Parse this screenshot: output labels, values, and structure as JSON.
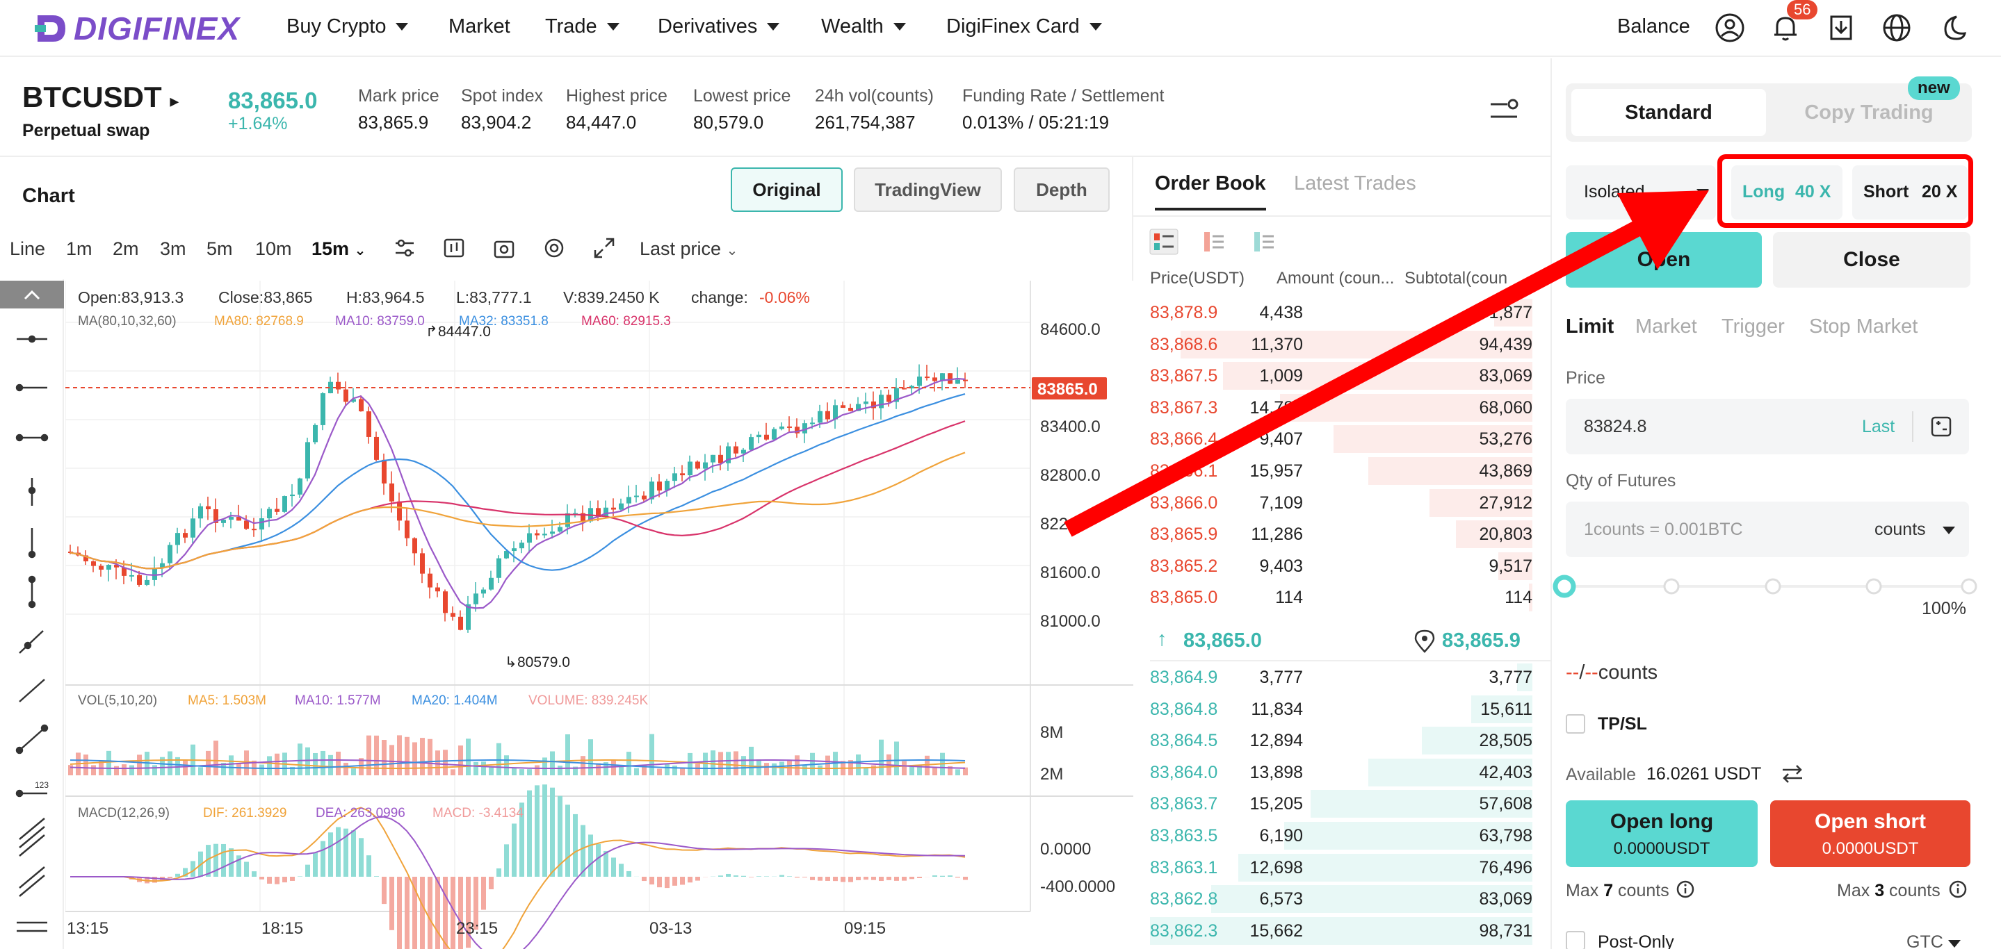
{
  "nav": {
    "logo": "DIGIFINEX",
    "items": [
      "Buy Crypto",
      "Market",
      "Trade",
      "Derivatives",
      "Wealth",
      "DigiFinex Card"
    ],
    "balance": "Balance",
    "notif_count": "56"
  },
  "ticker": {
    "symbol": "BTCUSDT",
    "type": "Perpetual swap",
    "last": "83,865.0",
    "change": "+1.64%",
    "stats": [
      {
        "label": "Mark price",
        "value": "83,865.9"
      },
      {
        "label": "Spot index",
        "value": "83,904.2"
      },
      {
        "label": "Highest price",
        "value": "84,447.0"
      },
      {
        "label": "Lowest price",
        "value": "80,579.0"
      },
      {
        "label": "24h vol(counts)",
        "value": "261,754,387"
      },
      {
        "label": "Funding Rate / Settlement",
        "value": "0.013% / 05:21:19"
      }
    ]
  },
  "chart": {
    "title": "Chart",
    "views": [
      "Original",
      "TradingView",
      "Depth"
    ],
    "active_view": "Original",
    "intervals": [
      "Line",
      "1m",
      "2m",
      "3m",
      "5m",
      "10m",
      "15m"
    ],
    "active_interval": "15m",
    "price_type": "Last price",
    "ohlc": {
      "open": "Open:83,913.3",
      "close": "Close:83,865",
      "high": "H:83,964.5",
      "low": "L:83,777.1",
      "vol": "V:839.2450 K",
      "change_label": "change:",
      "change_val": "-0.06%"
    },
    "ma": {
      "label": "MA(80,10,32,60)",
      "ma80": "MA80: 82768.9",
      "ma10": "MA10: 83759.0",
      "ma32": "MA32: 83351.8",
      "ma60": "MA60: 82915.3"
    },
    "vol_legend": {
      "label": "VOL(5,10,20)",
      "ma5": "MA5: 1.503M",
      "ma10": "MA10: 1.577M",
      "ma20": "MA20: 1.404M",
      "volume": "VOLUME: 839.245K"
    },
    "macd_legend": {
      "label": "MACD(12,26,9)",
      "dif": "DIF: 261.3929",
      "dea": "DEA: 263.0996",
      "macd": "MACD: -3.4134"
    },
    "price_axis": [
      "84600.0",
      "83400.0",
      "82800.0",
      "822",
      "81600.0",
      "81000.0"
    ],
    "current_price_tag": "83865.0",
    "high_marker": "84447.0",
    "low_marker": "80579.0",
    "vol_axis": [
      "8M",
      "2M"
    ],
    "macd_axis": [
      "0.0000",
      "-400.0000"
    ],
    "time_axis": [
      "13:15",
      "18:15",
      "23:15",
      "03-13",
      "09:15"
    ]
  },
  "orderbook": {
    "tabs": [
      "Order Book",
      "Latest Trades"
    ],
    "headers": [
      "Price(USDT)",
      "Amount (coun...",
      "Subtotal(coun"
    ],
    "asks": [
      {
        "price": "83,878.9",
        "amount": "4,438",
        "subtotal": "1,877",
        "depth": 0.1
      },
      {
        "price": "83,868.6",
        "amount": "11,370",
        "subtotal": "94,439",
        "depth": 0.92
      },
      {
        "price": "83,867.5",
        "amount": "1,009",
        "subtotal": "83,069",
        "depth": 0.81
      },
      {
        "price": "83,867.3",
        "amount": "14,784",
        "subtotal": "68,060",
        "depth": 0.66
      },
      {
        "price": "83,866.4",
        "amount": "9,407",
        "subtotal": "53,276",
        "depth": 0.52
      },
      {
        "price": "83,866.1",
        "amount": "15,957",
        "subtotal": "43,869",
        "depth": 0.43
      },
      {
        "price": "83,866.0",
        "amount": "7,109",
        "subtotal": "27,912",
        "depth": 0.27
      },
      {
        "price": "83,865.9",
        "amount": "11,286",
        "subtotal": "20,803",
        "depth": 0.2
      },
      {
        "price": "83,865.2",
        "amount": "9,403",
        "subtotal": "9,517",
        "depth": 0.09
      },
      {
        "price": "83,865.0",
        "amount": "114",
        "subtotal": "114",
        "depth": 0.01
      }
    ],
    "mid_last": "83,865.0",
    "mid_mark": "83,865.9",
    "bids": [
      {
        "price": "83,864.9",
        "amount": "3,777",
        "subtotal": "3,777",
        "depth": 0.04
      },
      {
        "price": "83,864.8",
        "amount": "11,834",
        "subtotal": "15,611",
        "depth": 0.16
      },
      {
        "price": "83,864.5",
        "amount": "12,894",
        "subtotal": "28,505",
        "depth": 0.29
      },
      {
        "price": "83,864.0",
        "amount": "13,898",
        "subtotal": "42,403",
        "depth": 0.43
      },
      {
        "price": "83,863.7",
        "amount": "15,205",
        "subtotal": "57,608",
        "depth": 0.58
      },
      {
        "price": "83,863.5",
        "amount": "6,190",
        "subtotal": "63,798",
        "depth": 0.65
      },
      {
        "price": "83,863.1",
        "amount": "12,698",
        "subtotal": "76,496",
        "depth": 0.77
      },
      {
        "price": "83,862.8",
        "amount": "6,573",
        "subtotal": "83,069",
        "depth": 0.84
      },
      {
        "price": "83,862.3",
        "amount": "15,662",
        "subtotal": "98,731",
        "depth": 1.0
      }
    ]
  },
  "trade": {
    "tabs": [
      "Standard",
      "Copy Trading"
    ],
    "new_badge": "new",
    "margin_mode": "Isolated",
    "long_label": "Long",
    "long_lev": "40 X",
    "short_label": "Short",
    "short_lev": "20 X",
    "open": "Open",
    "close": "Close",
    "order_types": [
      "Limit",
      "Market",
      "Trigger",
      "Stop Market"
    ],
    "price_label": "Price",
    "price_value": "83824.8",
    "last_btn": "Last",
    "qty_label": "Qty of Futures",
    "qty_placeholder": "1counts = 0.001BTC",
    "qty_unit": "counts",
    "slider_pct": "100%",
    "slider_value": 0,
    "counts_dash1": "--",
    "counts_slash": "/",
    "counts_dash2": "--",
    "counts_unit": "counts",
    "tpsl": "TP/SL",
    "available_label": "Available",
    "available_value": "16.0261 USDT",
    "open_long": "Open long",
    "open_long_amt": "0.0000USDT",
    "open_short": "Open short",
    "open_short_amt": "0.0000USDT",
    "max_long_prefix": "Max",
    "max_long_num": "7",
    "max_long_unit": "counts",
    "max_short_prefix": "Max",
    "max_short_num": "3",
    "max_short_unit": "counts",
    "post_only": "Post-Only",
    "gtc": "GTC"
  },
  "colors": {
    "green": "#3bb6ad",
    "red": "#e8472f",
    "accent_teal": "#5ad8d1",
    "annotation_red": "#ff0000"
  }
}
